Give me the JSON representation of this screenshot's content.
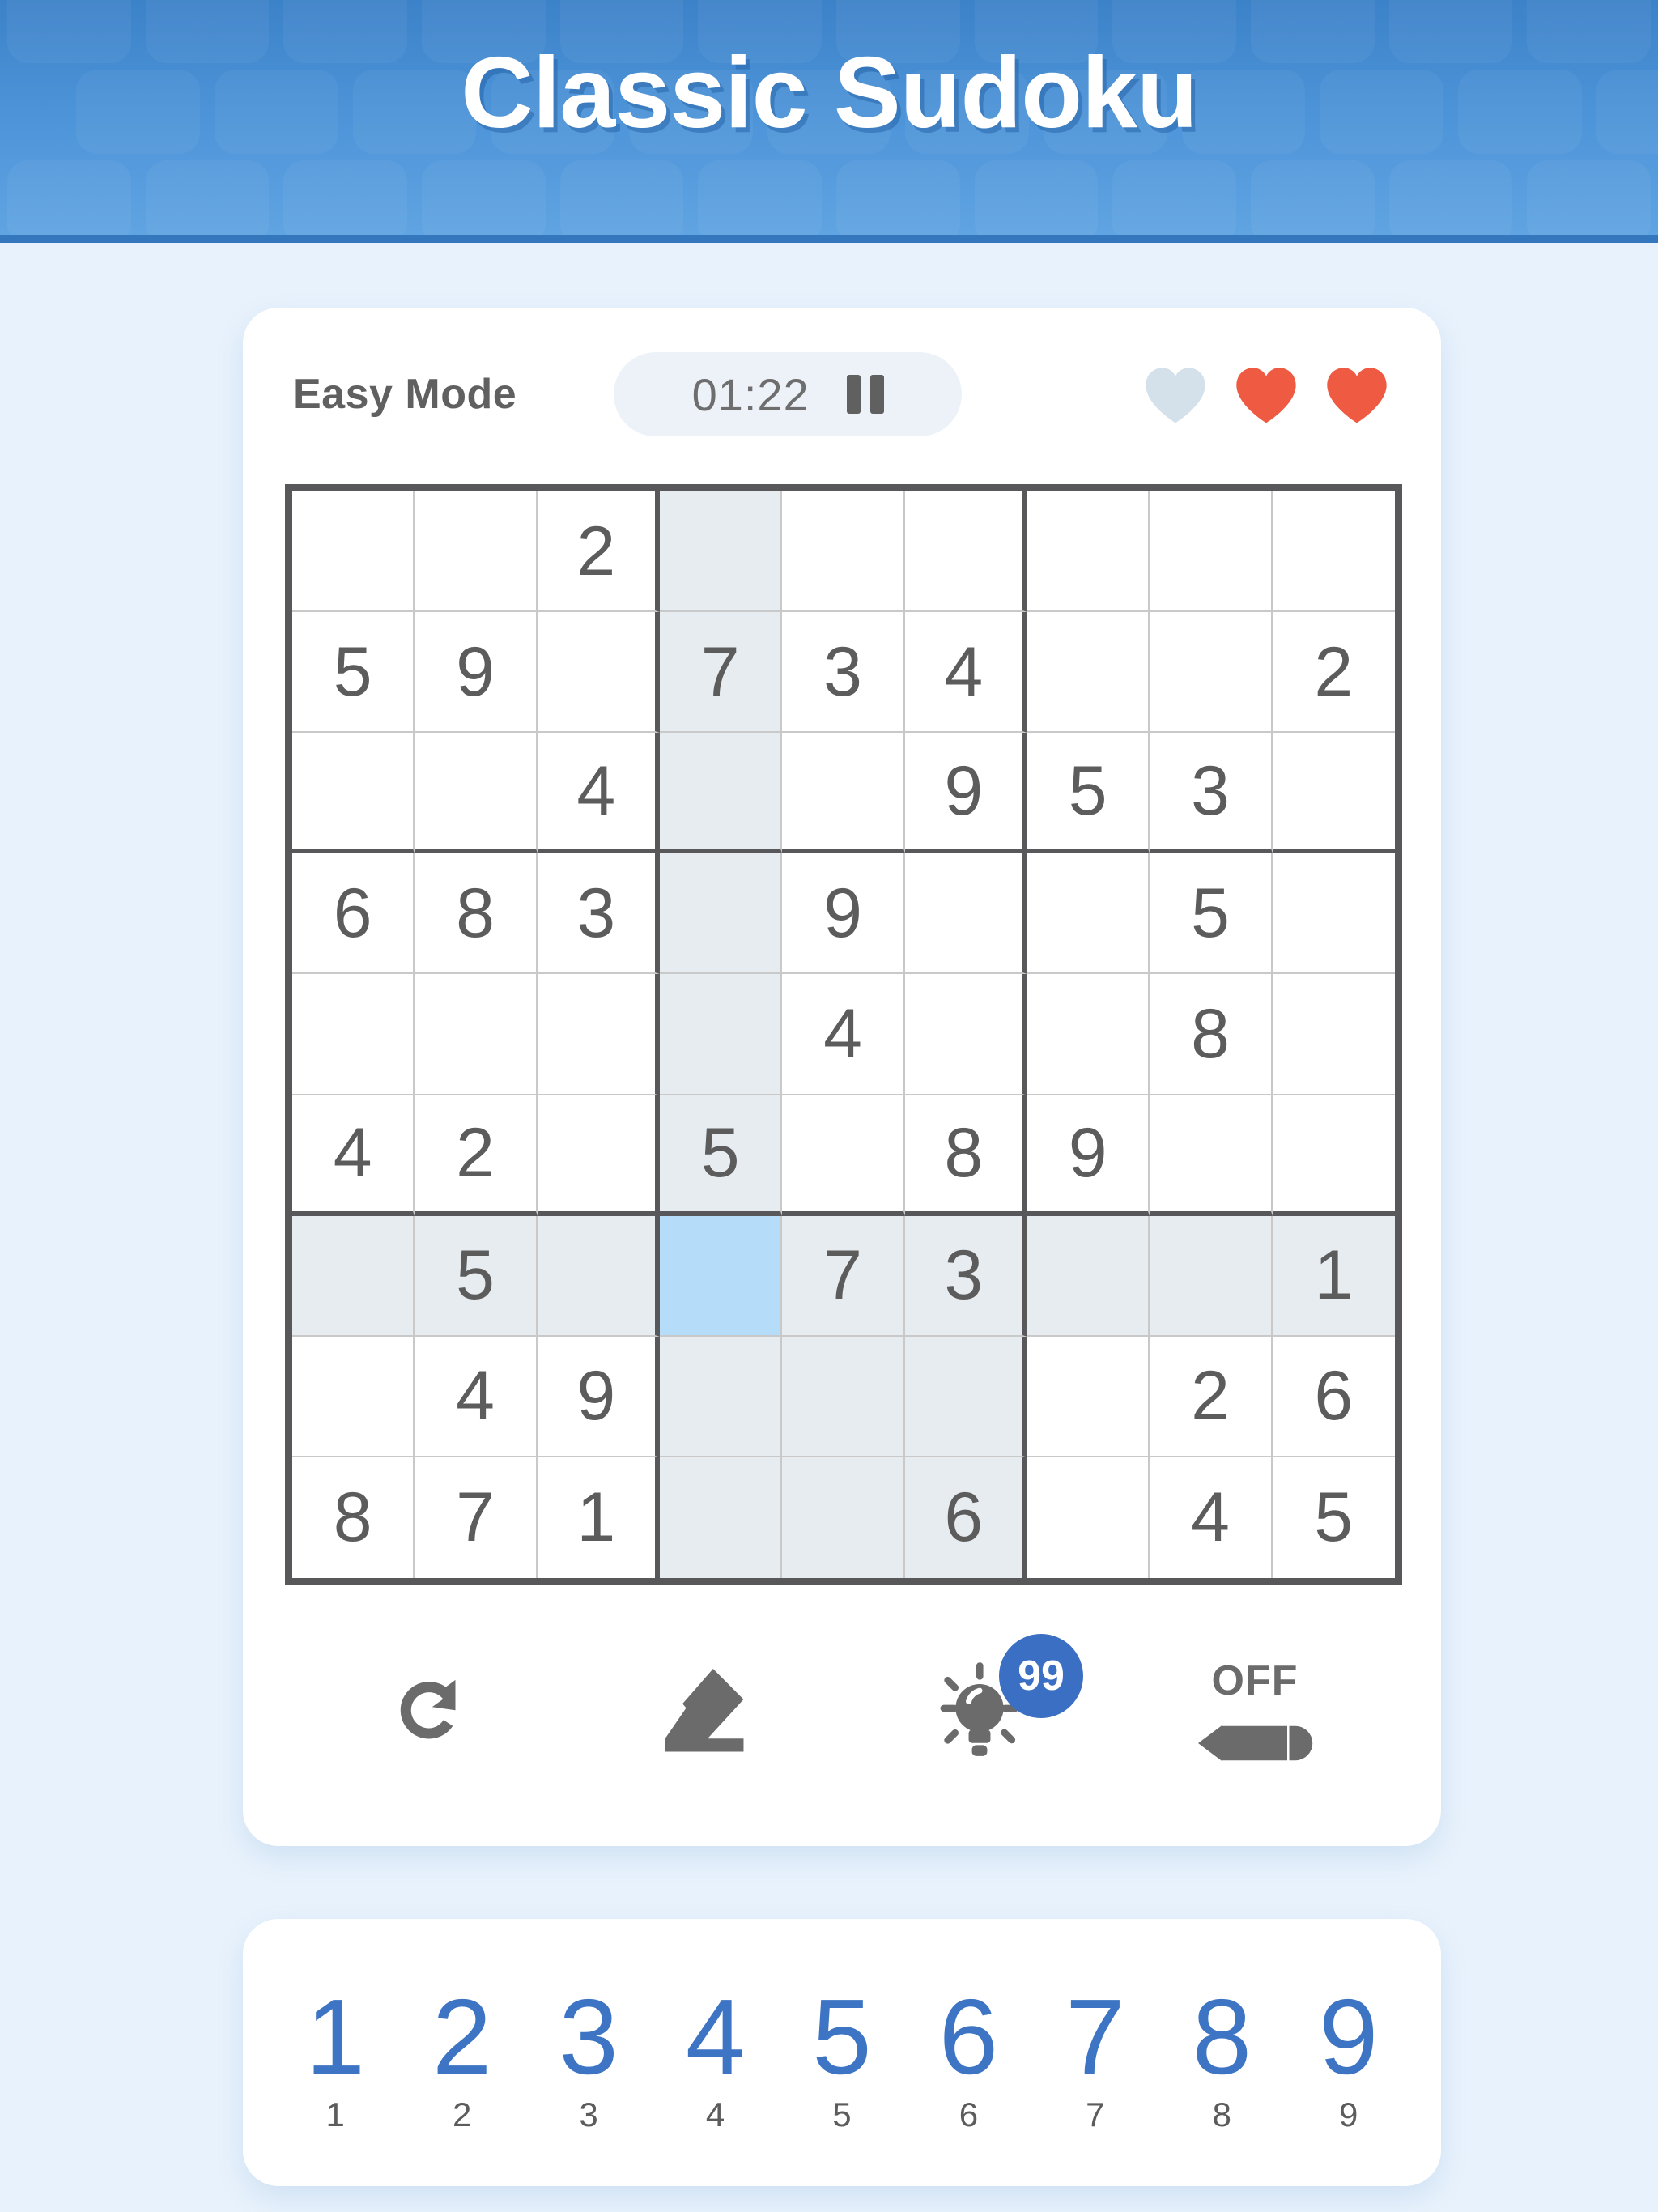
{
  "header": {
    "title": "Classic Sudoku",
    "bg_color": "#4C93D8"
  },
  "status": {
    "mode_label": "Easy Mode",
    "timer": "01:22",
    "pause_icon": "pause-icon",
    "hearts": [
      {
        "state": "empty",
        "color": "#D4E1EA"
      },
      {
        "state": "full",
        "color": "#EE5B42"
      },
      {
        "state": "full",
        "color": "#EE5B42"
      }
    ]
  },
  "grid": {
    "selected": {
      "row": 6,
      "col": 3
    },
    "highlight_color": "#E7ECF1",
    "selected_color": "#B5DCF8",
    "rows": [
      [
        "",
        "",
        "2",
        "",
        "",
        "",
        "",
        "",
        ""
      ],
      [
        "5",
        "9",
        "",
        "7",
        "3",
        "4",
        "",
        "",
        "2"
      ],
      [
        "",
        "",
        "4",
        "",
        "",
        "9",
        "5",
        "3",
        ""
      ],
      [
        "6",
        "8",
        "3",
        "",
        "9",
        "",
        "",
        "5",
        ""
      ],
      [
        "",
        "",
        "",
        "",
        "4",
        "",
        "",
        "8",
        ""
      ],
      [
        "4",
        "2",
        "",
        "5",
        "",
        "8",
        "9",
        "",
        ""
      ],
      [
        "",
        "5",
        "",
        "",
        "7",
        "3",
        "",
        "",
        "1"
      ],
      [
        "",
        "4",
        "9",
        "",
        "",
        "",
        "",
        "2",
        "6"
      ],
      [
        "8",
        "7",
        "1",
        "",
        "",
        "6",
        "",
        "4",
        "5"
      ]
    ]
  },
  "toolbar": {
    "undo_label": "undo-icon",
    "eraser_label": "eraser-icon",
    "hint_label": "hint-icon",
    "hint_count": "99",
    "pencil_label": "pencil-icon",
    "pencil_state": "OFF",
    "badge_color": "#3B6FC4"
  },
  "numpad": {
    "accent_color": "#3D74C4",
    "keys": [
      {
        "digit": "1",
        "count": "1"
      },
      {
        "digit": "2",
        "count": "2"
      },
      {
        "digit": "3",
        "count": "3"
      },
      {
        "digit": "4",
        "count": "4"
      },
      {
        "digit": "5",
        "count": "5"
      },
      {
        "digit": "6",
        "count": "6"
      },
      {
        "digit": "7",
        "count": "7"
      },
      {
        "digit": "8",
        "count": "8"
      },
      {
        "digit": "9",
        "count": "9"
      }
    ]
  }
}
